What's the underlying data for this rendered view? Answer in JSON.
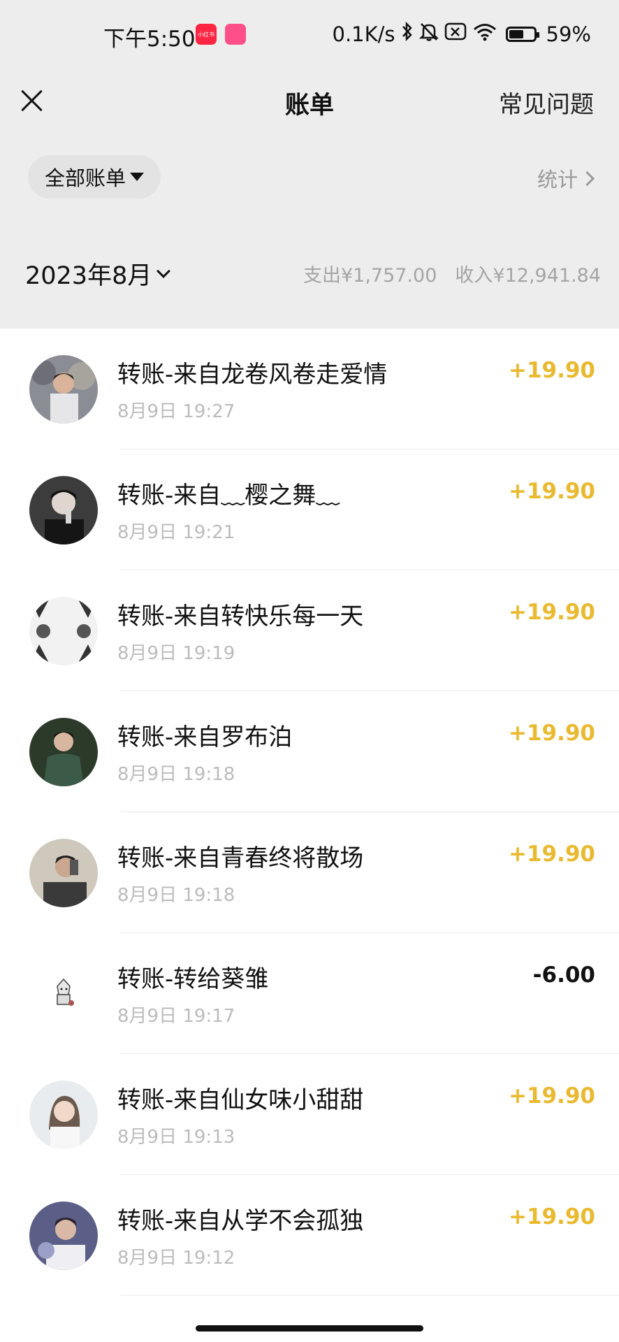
{
  "status_bar": {
    "time": "下午5:50",
    "app_badge_text": "小红书",
    "network_speed": "0.1K/s",
    "battery": "59%",
    "battery_level": 0.59,
    "icons": [
      "bluetooth-icon",
      "mute-icon",
      "sim-icon",
      "wifi-icon",
      "battery-icon"
    ]
  },
  "nav": {
    "title": "账单",
    "faq_label": "常见问题"
  },
  "filter": {
    "label": "全部账单",
    "stats_label": "统计"
  },
  "month": {
    "label": "2023年8月",
    "expense": "支出¥1,757.00",
    "income": "收入¥12,941.84"
  },
  "colors": {
    "income": "#e9b92f",
    "expense": "#111111",
    "background_top": "#ededed"
  },
  "transactions": [
    {
      "title": "转账-来自龙卷风卷走爱情",
      "time": "8月9日 19:27",
      "amount": "+19.90",
      "type": "income"
    },
    {
      "title": "转账-来自﹏樱之舞﹏",
      "time": "8月9日 19:21",
      "amount": "+19.90",
      "type": "income"
    },
    {
      "title": "转账-来自转快乐每一天",
      "time": "8月9日 19:19",
      "amount": "+19.90",
      "type": "income"
    },
    {
      "title": "转账-来自罗布泊",
      "time": "8月9日 19:18",
      "amount": "+19.90",
      "type": "income"
    },
    {
      "title": "转账-来自青春终将散场",
      "time": "8月9日 19:18",
      "amount": "+19.90",
      "type": "income"
    },
    {
      "title": "转账-转给葵雏",
      "time": "8月9日 19:17",
      "amount": "-6.00",
      "type": "expense"
    },
    {
      "title": "转账-来自仙女味小甜甜",
      "time": "8月9日 19:13",
      "amount": "+19.90",
      "type": "income"
    },
    {
      "title": "转账-来自从学不会孤独",
      "time": "8月9日 19:12",
      "amount": "+19.90",
      "type": "income"
    }
  ]
}
